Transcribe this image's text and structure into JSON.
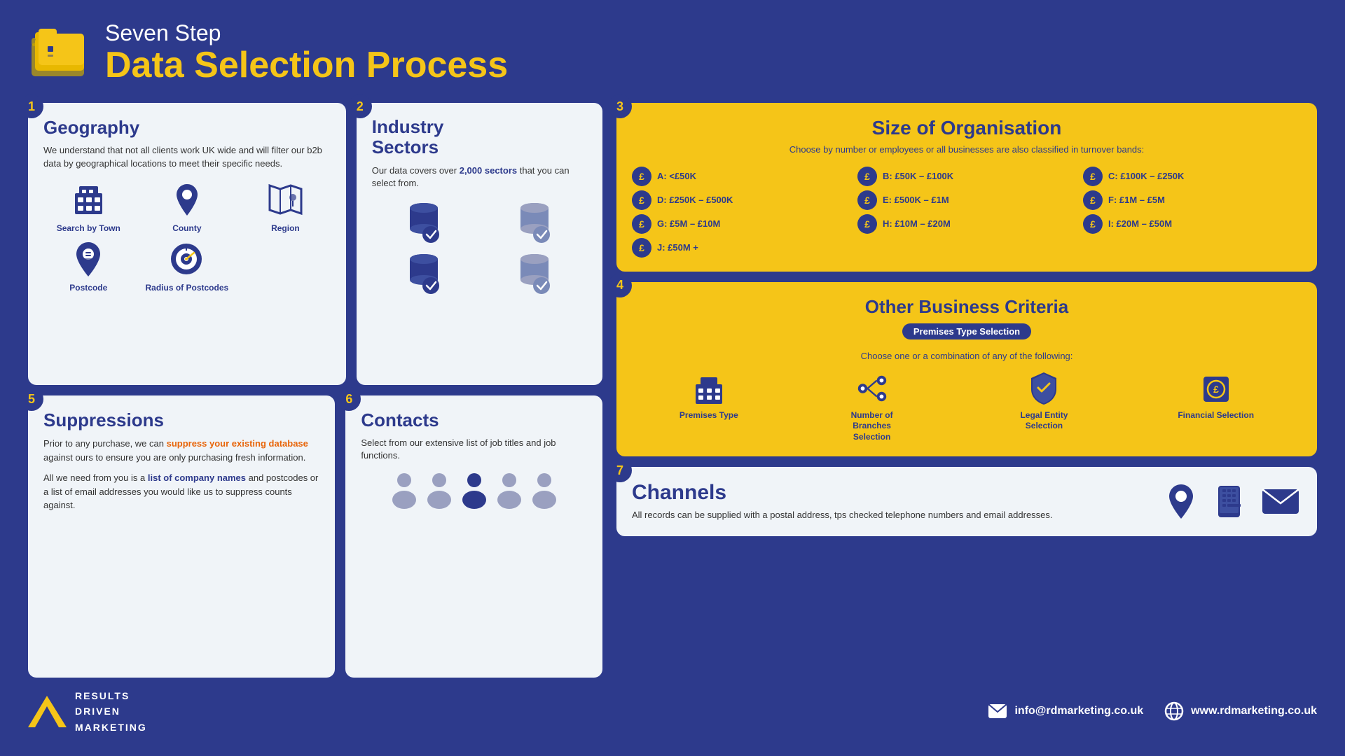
{
  "header": {
    "subtitle": "Seven Step",
    "title": "Data Selection Process"
  },
  "steps": {
    "step1": {
      "number": "1",
      "title": "Geography",
      "description": "We understand that not all clients work UK wide and will filter our b2b data by geographical locations to meet their specific needs.",
      "icons": [
        {
          "name": "Search by Town",
          "icon": "building"
        },
        {
          "name": "County",
          "icon": "location"
        },
        {
          "name": "Region",
          "icon": "map"
        },
        {
          "name": "Postcode",
          "icon": "postcode"
        },
        {
          "name": "Radius of Postcodes",
          "icon": "radius"
        }
      ]
    },
    "step2": {
      "number": "2",
      "title": "Industry Sectors",
      "description_prefix": "Our data covers over ",
      "highlight": "2,000 sectors",
      "description_suffix": " that you can select from."
    },
    "step3": {
      "number": "3",
      "title": "Size of Organisation",
      "description": "Choose by number or employees or all businesses are also classified in turnover bands:",
      "bands": [
        {
          "label": "A: <£50K",
          "col": 1
        },
        {
          "label": "B: £50K – £100K",
          "col": 1
        },
        {
          "label": "C: £100K – £250K",
          "col": 1
        },
        {
          "label": "D: £250K – £500K",
          "col": 1
        },
        {
          "label": "E: £500K – £1M",
          "col": 2
        },
        {
          "label": "F: £1M – £5M",
          "col": 2
        },
        {
          "label": "G: £5M – £10M",
          "col": 2
        },
        {
          "label": "H: £10M – £20M",
          "col": 2
        },
        {
          "label": "I: £20M – £50M",
          "col": 3
        },
        {
          "label": "J: £50M +",
          "col": 3
        }
      ]
    },
    "step4": {
      "number": "4",
      "title": "Other Business Criteria",
      "badge": "Premises Type Selection",
      "description": "Choose one or a combination of any of the following:",
      "icons": [
        {
          "name": "Premises Type",
          "icon": "building2"
        },
        {
          "name": "Number of Branches Selection",
          "icon": "branches"
        },
        {
          "name": "Legal Entity Selection",
          "icon": "legal"
        },
        {
          "name": "Financial Selection",
          "icon": "financial"
        }
      ]
    },
    "step5": {
      "number": "5",
      "title": "Suppressions",
      "para1_prefix": "Prior to any purchase, we can ",
      "para1_highlight_orange": "suppress your existing database",
      "para1_suffix": " against ours to ensure you are only purchasing fresh information.",
      "para2_prefix": "All we need from you is a ",
      "para2_highlight_blue": "list of company names",
      "para2_suffix": " and postcodes or a list of email addresses you would like us to suppress counts against."
    },
    "step6": {
      "number": "6",
      "title": "Contacts",
      "description": "Select from our extensive list of job titles and job functions."
    },
    "step7": {
      "number": "7",
      "title": "Channels",
      "description": "All records can be supplied with a postal address, tps checked telephone numbers and email addresses."
    }
  },
  "footer": {
    "logo_lines": [
      "RESULTS",
      "DRIVEN",
      "MARKETING"
    ],
    "email": "info@rdmarketing.co.uk",
    "website": "www.rdmarketing.co.uk"
  }
}
